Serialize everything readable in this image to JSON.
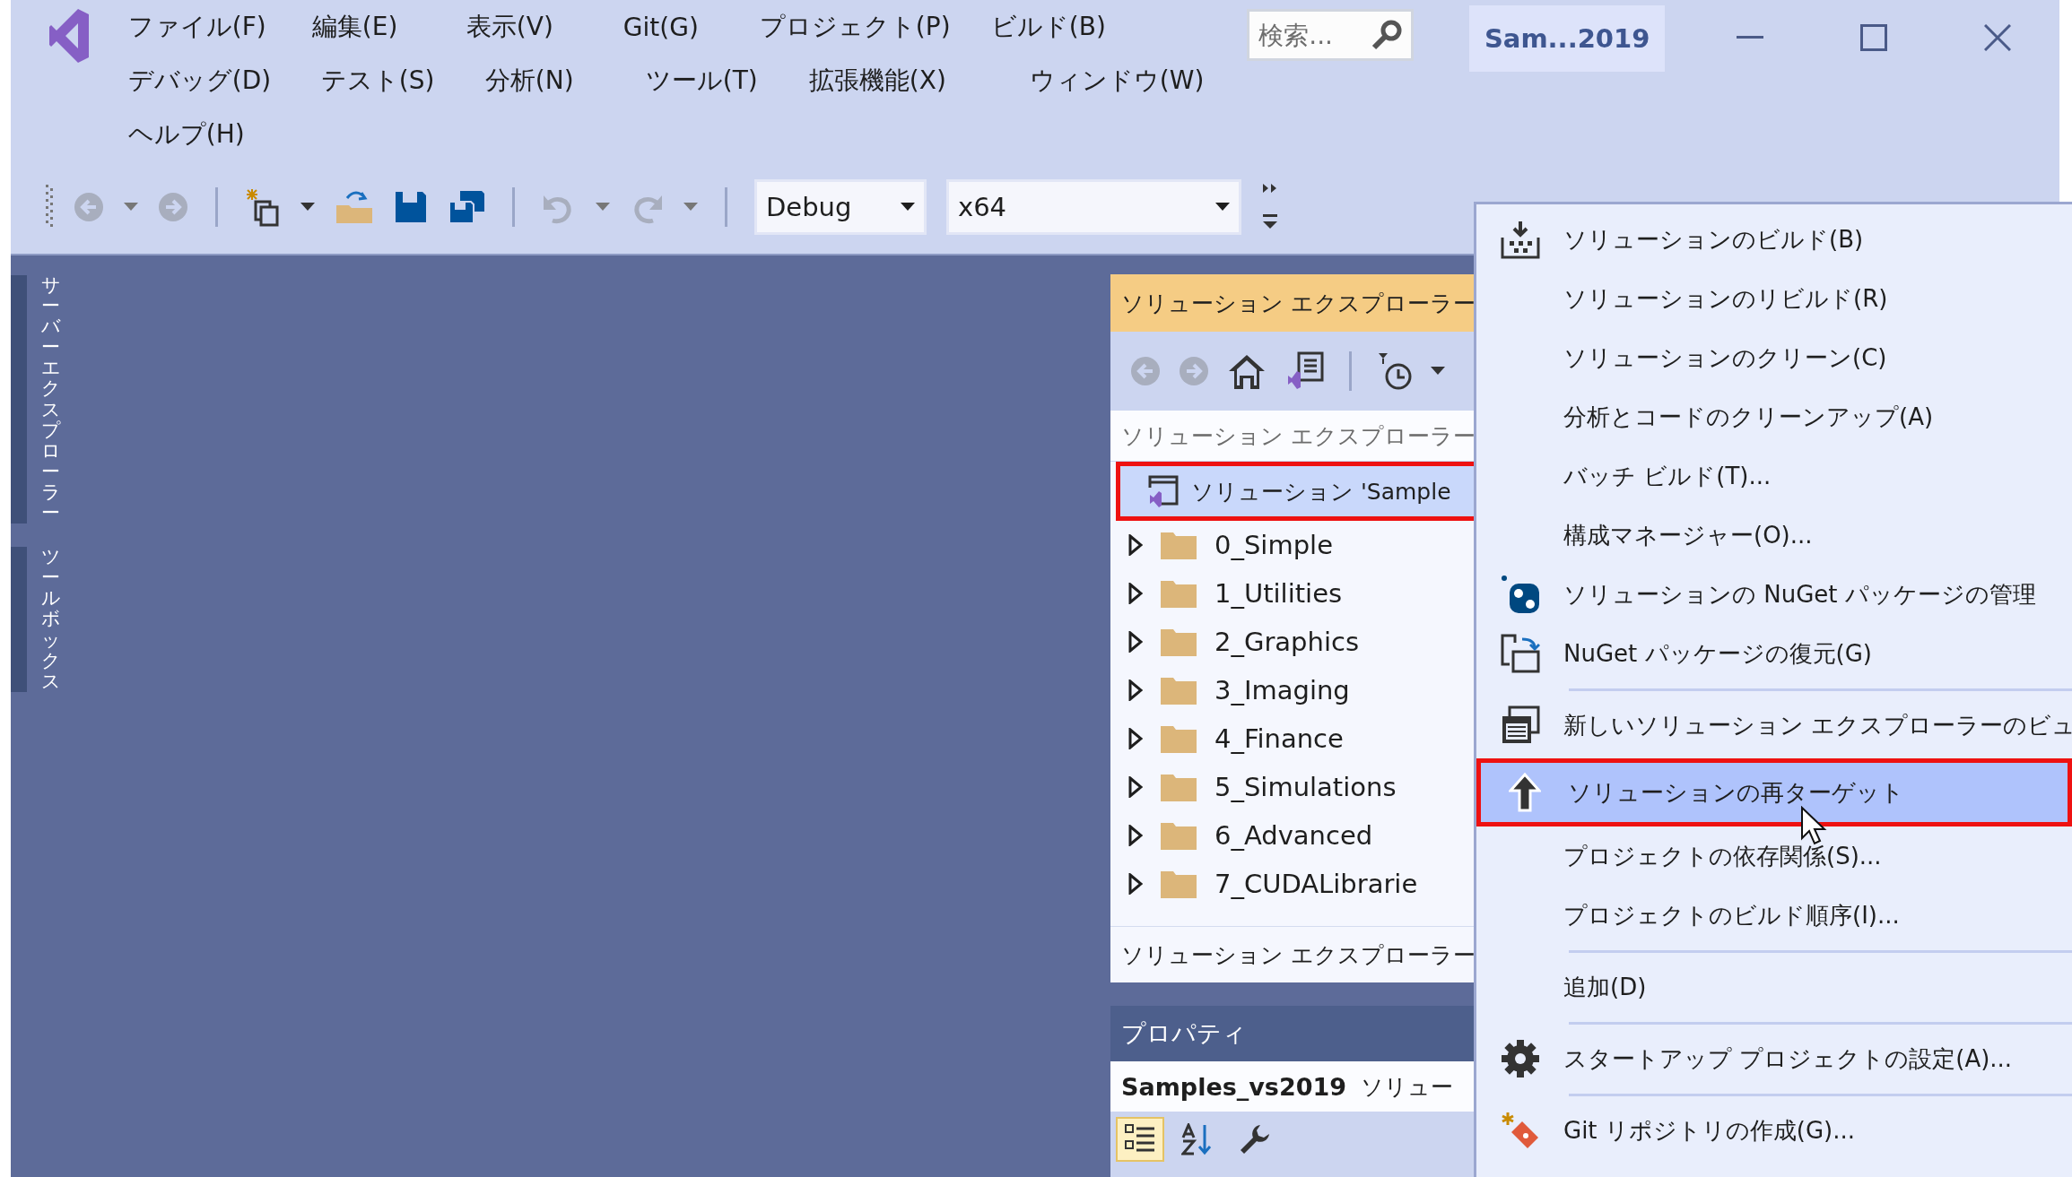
{
  "window": {
    "title": "Sam...2019"
  },
  "menu_rows": [
    [
      "ファイル(F)",
      "編集(E)",
      "表示(V)",
      "Git(G)",
      "プロジェクト(P)",
      "ビルド(B)"
    ],
    [
      "デバッグ(D)",
      "テスト(S)",
      "分析(N)",
      "ツール(T)",
      "拡張機能(X)",
      "ウィンドウ(W)"
    ],
    [
      "ヘルプ(H)"
    ]
  ],
  "search": {
    "placeholder": "検索..."
  },
  "toolbar": {
    "configuration": "Debug",
    "platform": "x64"
  },
  "side_tabs": [
    "サーバーエクスプローラー",
    "ツールボックス"
  ],
  "solution_explorer": {
    "title": "ソリューション エクスプローラー",
    "search_placeholder": "ソリューション エクスプローラー",
    "bottom_tab": "ソリューション エクスプローラー",
    "tree": [
      {
        "label": "ソリューション 'Sample",
        "selected": true,
        "annotated": true,
        "children": [
          {
            "label": "0_Simple",
            "expanded": false
          },
          {
            "label": "1_Utilities",
            "expanded": false
          },
          {
            "label": "2_Graphics",
            "expanded": false
          },
          {
            "label": "3_Imaging",
            "expanded": false
          },
          {
            "label": "4_Finance",
            "expanded": false
          },
          {
            "label": "5_Simulations",
            "expanded": false
          },
          {
            "label": "6_Advanced",
            "expanded": false
          },
          {
            "label": "7_CUDALibrarie",
            "expanded": false
          }
        ]
      }
    ]
  },
  "properties": {
    "title": "プロパティ",
    "object_name": "Samples_vs2019",
    "object_type": "ソリュー",
    "toolbar": [
      {
        "kind": "categorized",
        "selected": true
      },
      {
        "kind": "alphabetical",
        "selected": false
      },
      {
        "kind": "wrench",
        "selected": false
      }
    ]
  },
  "context_menu": [
    {
      "kind": "item",
      "label": "ソリューションのビルド(B)",
      "selected": false
    },
    {
      "kind": "item",
      "label": "ソリューションのリビルド(R)",
      "selected": false
    },
    {
      "kind": "item",
      "label": "ソリューションのクリーン(C)",
      "selected": false
    },
    {
      "kind": "item",
      "label": "分析とコードのクリーンアップ(A)",
      "selected": false
    },
    {
      "kind": "item",
      "label": "バッチ ビルド(T)...",
      "selected": false
    },
    {
      "kind": "item",
      "label": "構成マネージャー(O)...",
      "selected": false
    },
    {
      "kind": "item",
      "label": "ソリューションの NuGet パッケージの管理",
      "selected": false
    },
    {
      "kind": "item",
      "label": "NuGet パッケージの復元(G)",
      "selected": false
    },
    {
      "kind": "separator"
    },
    {
      "kind": "item",
      "label": "新しいソリューション エクスプローラーのビュ",
      "selected": false
    },
    {
      "kind": "item",
      "label": "ソリューションの再ターゲット",
      "selected": true,
      "annotated": true
    },
    {
      "kind": "item",
      "label": "プロジェクトの依存関係(S)...",
      "selected": false
    },
    {
      "kind": "item",
      "label": "プロジェクトのビルド順序(I)...",
      "selected": false
    },
    {
      "kind": "separator"
    },
    {
      "kind": "item",
      "label": "追加(D)",
      "selected": false
    },
    {
      "kind": "separator"
    },
    {
      "kind": "item",
      "label": "スタートアップ プロジェクトの設定(A)...",
      "selected": false
    },
    {
      "kind": "separator"
    },
    {
      "kind": "item",
      "label": "Git リポジトリの作成(G)...",
      "selected": false
    }
  ]
}
